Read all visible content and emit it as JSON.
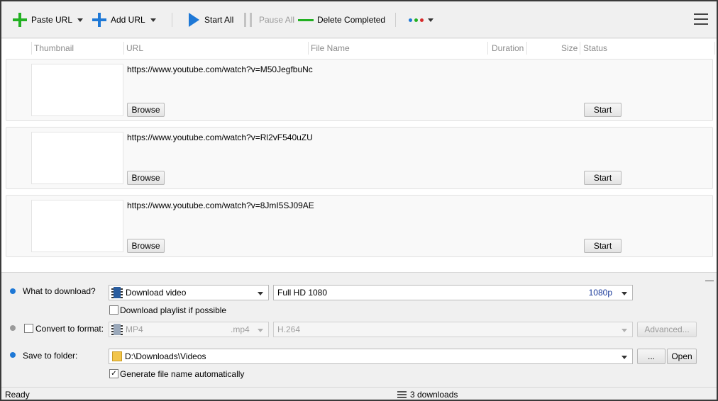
{
  "toolbar": {
    "paste_url": "Paste URL",
    "add_url": "Add URL",
    "start_all": "Start All",
    "pause_all": "Pause All",
    "delete_completed": "Delete Completed"
  },
  "columns": [
    "Thumbnail",
    "URL",
    "File Name",
    "Duration",
    "Size",
    "Status"
  ],
  "rows": [
    {
      "url": "https://www.youtube.com/watch?v=M50JegfbuNc",
      "browse": "Browse",
      "start": "Start"
    },
    {
      "url": "https://www.youtube.com/watch?v=Rl2vF540uZU",
      "browse": "Browse",
      "start": "Start"
    },
    {
      "url": "https://www.youtube.com/watch?v=8JmI5SJ09AE",
      "browse": "Browse",
      "start": "Start"
    }
  ],
  "options": {
    "what_label": "What to download?",
    "what_value": "Download video",
    "quality_value": "Full HD 1080",
    "quality_tag": "1080p",
    "playlist_label": "Download playlist if possible",
    "convert_label": "Convert to format:",
    "format_value": "MP4",
    "format_ext": ".mp4",
    "codec_value": "H.264",
    "advanced": "Advanced...",
    "save_label": "Save to folder:",
    "folder_value": "D:\\Downloads\\Videos",
    "browse_dots": "...",
    "open": "Open",
    "autoname_label": "Generate file name automatically"
  },
  "status": {
    "ready": "Ready",
    "downloads": "3 downloads"
  },
  "colors": {
    "accent_blue": "#1e78d6",
    "green": "#22b022",
    "red": "#d62a2a"
  }
}
